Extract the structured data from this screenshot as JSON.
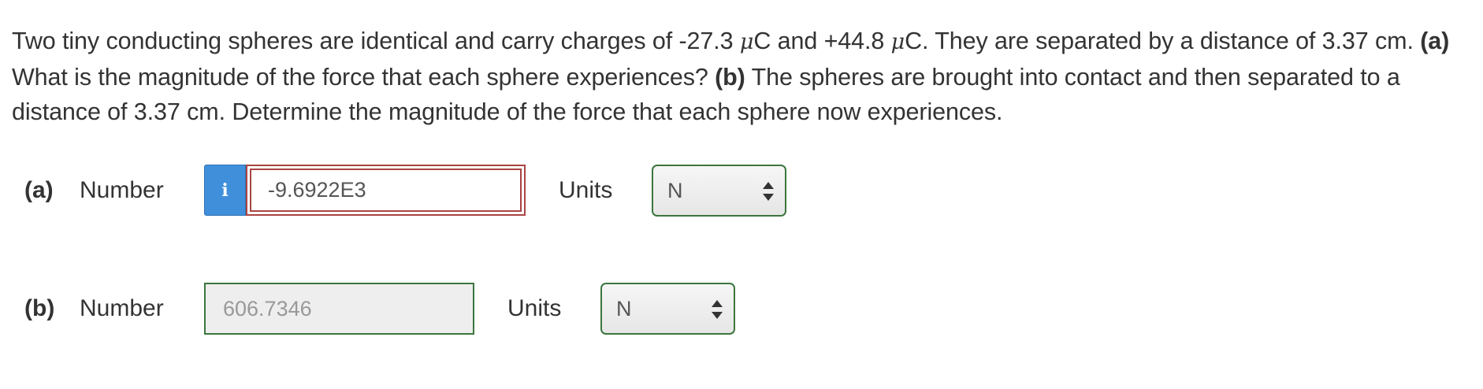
{
  "question": {
    "segment_1": "Two tiny conducting spheres are identical and carry charges of -27.3 ",
    "mu_1": "μ",
    "segment_2": "C and +44.8 ",
    "mu_2": "μ",
    "segment_3": "C. They are separated by a distance of 3.37 cm. ",
    "part_a_marker": "(a)",
    "segment_4": " What is the magnitude of the force that each sphere experiences? ",
    "part_b_marker": "(b)",
    "segment_5": " The spheres are brought into contact and then separated to a distance of 3.37 cm. Determine the magnitude of the force that each sphere now experiences."
  },
  "part_a": {
    "label": "(a)",
    "number_label": "Number",
    "info_icon": "info-icon",
    "info_glyph": "i",
    "value": "-9.6922E3",
    "units_label": "Units",
    "unit_value": "N",
    "input_border_color": "#a94442"
  },
  "part_b": {
    "label": "(b)",
    "number_label": "Number",
    "value": "606.7346",
    "units_label": "Units",
    "unit_value": "N",
    "input_border_color": "#3c763d"
  },
  "colors": {
    "info_button": "#3f8fdb",
    "error_border": "#a94442",
    "success_border": "#3c763d",
    "text": "#333333"
  }
}
